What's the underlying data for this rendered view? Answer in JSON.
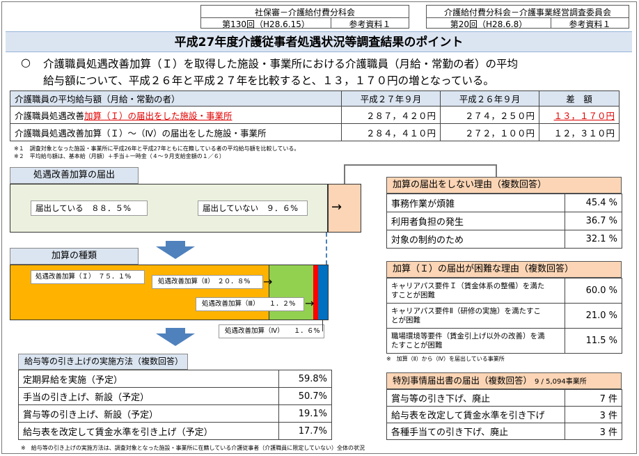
{
  "header": {
    "left": {
      "org": "社保審－介護給付費分科会",
      "meeting": "第130回（H28.6.15）",
      "ref": "参考資料１"
    },
    "right": {
      "org": "介護給付費分科会－介護事業経営調査委員会",
      "meeting": "第20回（H28.6.8）",
      "ref": "参考資料１"
    }
  },
  "title": "平成27年度介護従事者処遇状況等調査結果のポイント",
  "summary": {
    "bullet": "○",
    "line1": "介護職員処遇改善加算（Ｉ）を取得した施設・事業所における介護職員（月給・常勤の者）の平均",
    "line2": "給与額について、平成２６年と平成２７年を比較すると、１３，１７０円の増となっている。"
  },
  "salary_table": {
    "headers": [
      "介護職員の平均給与額（月給・常勤の者）",
      "平成２７年９月",
      "平成２６年９月",
      "差　額"
    ],
    "row1": {
      "label_prefix": "介護職員処遇改善",
      "label_highlight": "加算（Ｉ）の届出をした施設・事業所",
      "h27": "２８７，４２０円",
      "h26": "２７４，２５０円",
      "diff": "１３，１７０円"
    },
    "row2": {
      "label": "介護職員処遇改善加算（Ｉ）～（Ⅳ）の届出をした施設・事業所",
      "h27": "２８４，４１０円",
      "h26": "２７２，１００円",
      "diff": "１２，３１０円"
    }
  },
  "notes": {
    "n1": "※１　調査対象となった施設・事業所に平成26年と平成27年ともに在籍している者の平均給与額を比較している。",
    "n2": "※２　平均給与額は、基本給（月額）＋手当＋一時金（４～９月支給金額の１／６）"
  },
  "filing": {
    "title": "処遇改善加算の届出",
    "filed": "届出している　８８．５%",
    "not_filed": "届出していない　９．６%",
    "arrow": "→"
  },
  "types": {
    "title": "加算の種類",
    "t1": "処遇改善加算（Ｉ）　７５．１%",
    "t2": "処遇改善加算（Ⅱ）　２０．８%",
    "t3": "処遇改善加算（Ⅲ）　　１．２%",
    "t4": "処遇改善加算（Ⅳ）　　１．６%"
  },
  "reasons_not_filing": {
    "title": "加算の届出をしない理由（複数回答）",
    "rows": [
      {
        "label": "事務作業が煩雑",
        "value": "45.4 %"
      },
      {
        "label": "利用者負担の発生",
        "value": "36.7 %"
      },
      {
        "label": "対象の制約のため",
        "value": "32.1 %"
      }
    ]
  },
  "reasons_difficult": {
    "title": "加算（Ｉ）の届出が困難な理由（複数回答）",
    "rows": [
      {
        "l1": "キャリアパス要件Ｉ（賃金体系の整備）を満た",
        "l2": "すことが困難",
        "value": "60.0 %"
      },
      {
        "l1": "キャリアパス要件Ⅱ（研修の実施）を満たすこ",
        "l2": "とが困難",
        "value": "21.0 %"
      },
      {
        "l1": "職場環境等要件（賃金引上げ以外の改善）を満",
        "l2": "たすことが困難",
        "value": "11.5 %"
      }
    ],
    "note": "※　加算（Ⅱ）から（Ⅳ）を届出している事業所"
  },
  "raise_methods": {
    "title": "給与等の引き上げの実施方法（複数回答）",
    "rows": [
      {
        "label": "定期昇給を実施（予定）",
        "value": "59.8%"
      },
      {
        "label": "手当の引き上げ、新設（予定）",
        "value": "50.7%"
      },
      {
        "label": "賞与等の引き上げ、新設（予定）",
        "value": "19.1%"
      },
      {
        "label": "給与表を改定して賃金水準を引き上げ（予定）",
        "value": "17.7%"
      }
    ],
    "note": "※　給与等の引き上げの実施方法は、調査対象となった施設・事業所に在籍している介護従事者（介護職員に限定していない）全体の状況"
  },
  "special": {
    "title": "特別事情届出書の届出（複数回答）",
    "count": "9 / 5,094事業所",
    "rows": [
      {
        "label": "賞与等の引き下げ、廃止",
        "value": "7 件"
      },
      {
        "label": "給与表を改定して賃金水準を引き下げ",
        "value": "3 件"
      },
      {
        "label": "各種手当ての引き下げ、廃止",
        "value": "3 件"
      }
    ]
  },
  "colors": {
    "orange": "#ffb300",
    "green": "#92d050",
    "lightgreen": "#ebf1de",
    "peach": "#fbd5b5",
    "red": "#ff0000",
    "blue": "#0070c0",
    "arrowblue": "#4f81bd"
  }
}
